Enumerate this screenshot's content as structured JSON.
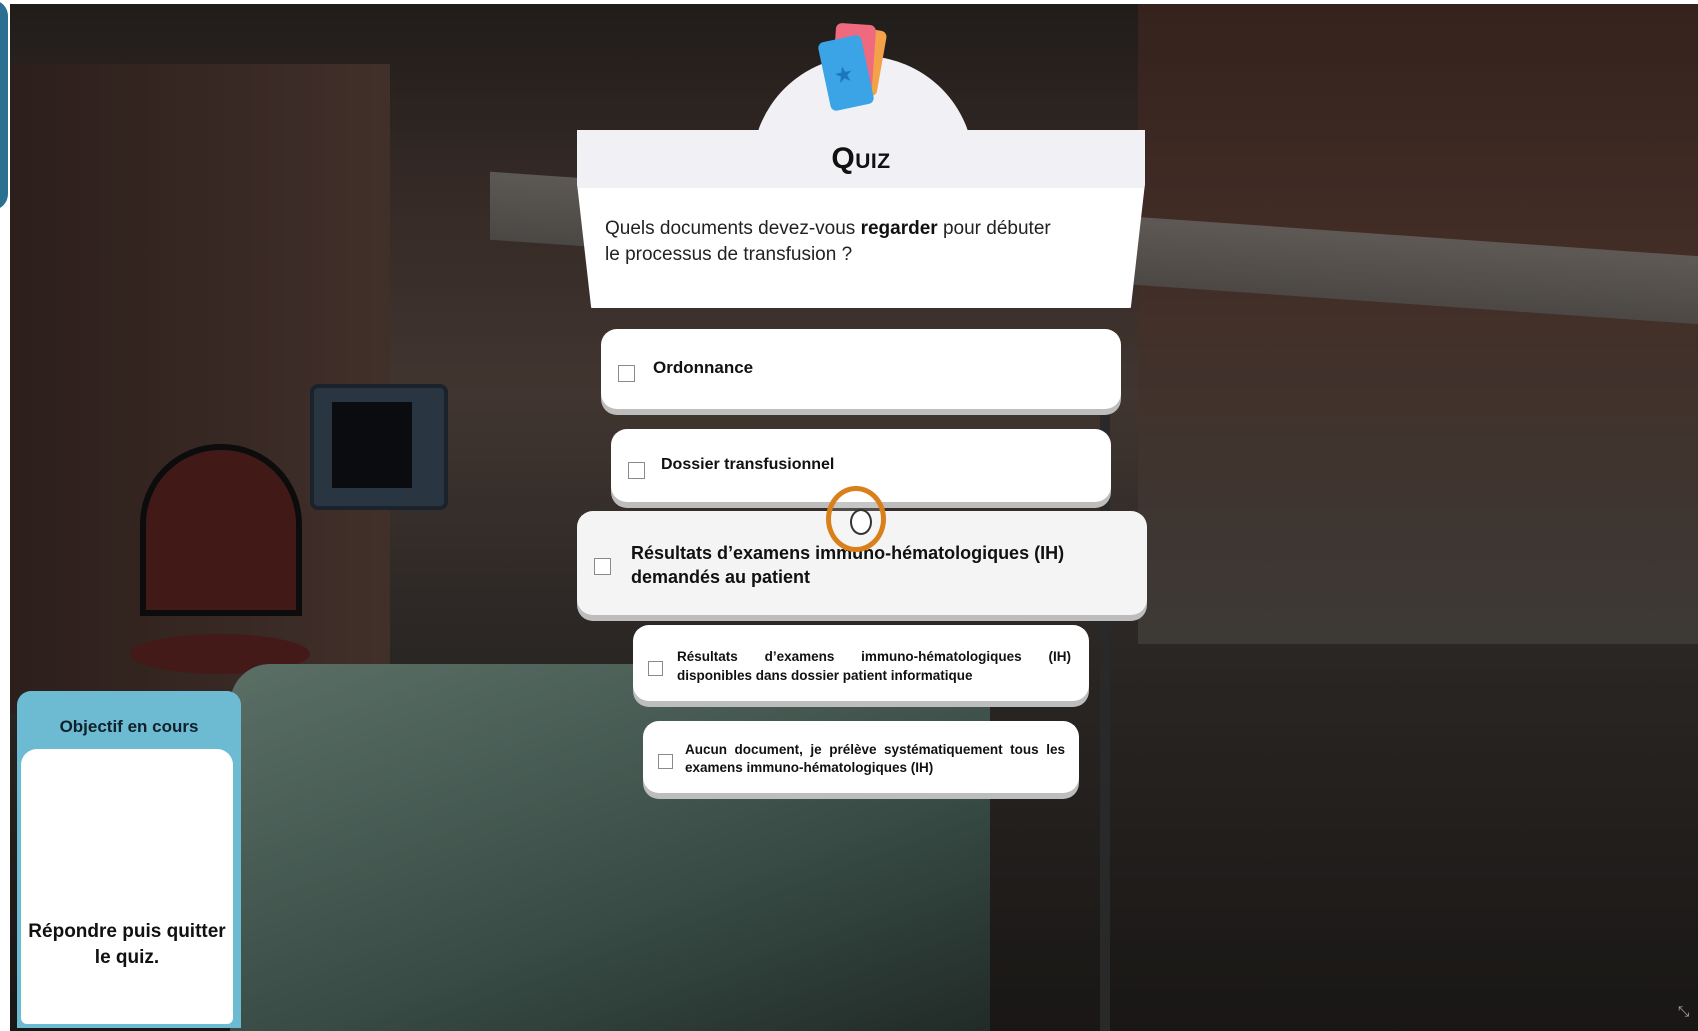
{
  "quiz": {
    "title": "Quiz",
    "question_pre": "Quels documents devez-vous ",
    "question_bold": "regarder",
    "question_post": " pour débuter le processus de transfusion ?",
    "answers": [
      {
        "label": "Ordonnance"
      },
      {
        "label": "Dossier transfusionnel"
      },
      {
        "label": "Résultats d’examens immuno-hématologiques (IH) demandés au patient"
      },
      {
        "label": "Résultats d’examens immuno-hématologiques (IH) disponibles dans dossier patient informatique"
      },
      {
        "label": "Aucun document, je prélève systématiquement tous les examens immuno-hématologiques (IH)"
      }
    ]
  },
  "objective": {
    "label": "Objectif en cours",
    "text": "Répondre puis quitter le quiz."
  },
  "colors": {
    "objective_panel": "#6cbbd3",
    "cursor_ring": "#d9801c",
    "card_blue": "#3aa4e6",
    "card_pink": "#ef6a7e",
    "card_orange": "#f3a24a"
  }
}
